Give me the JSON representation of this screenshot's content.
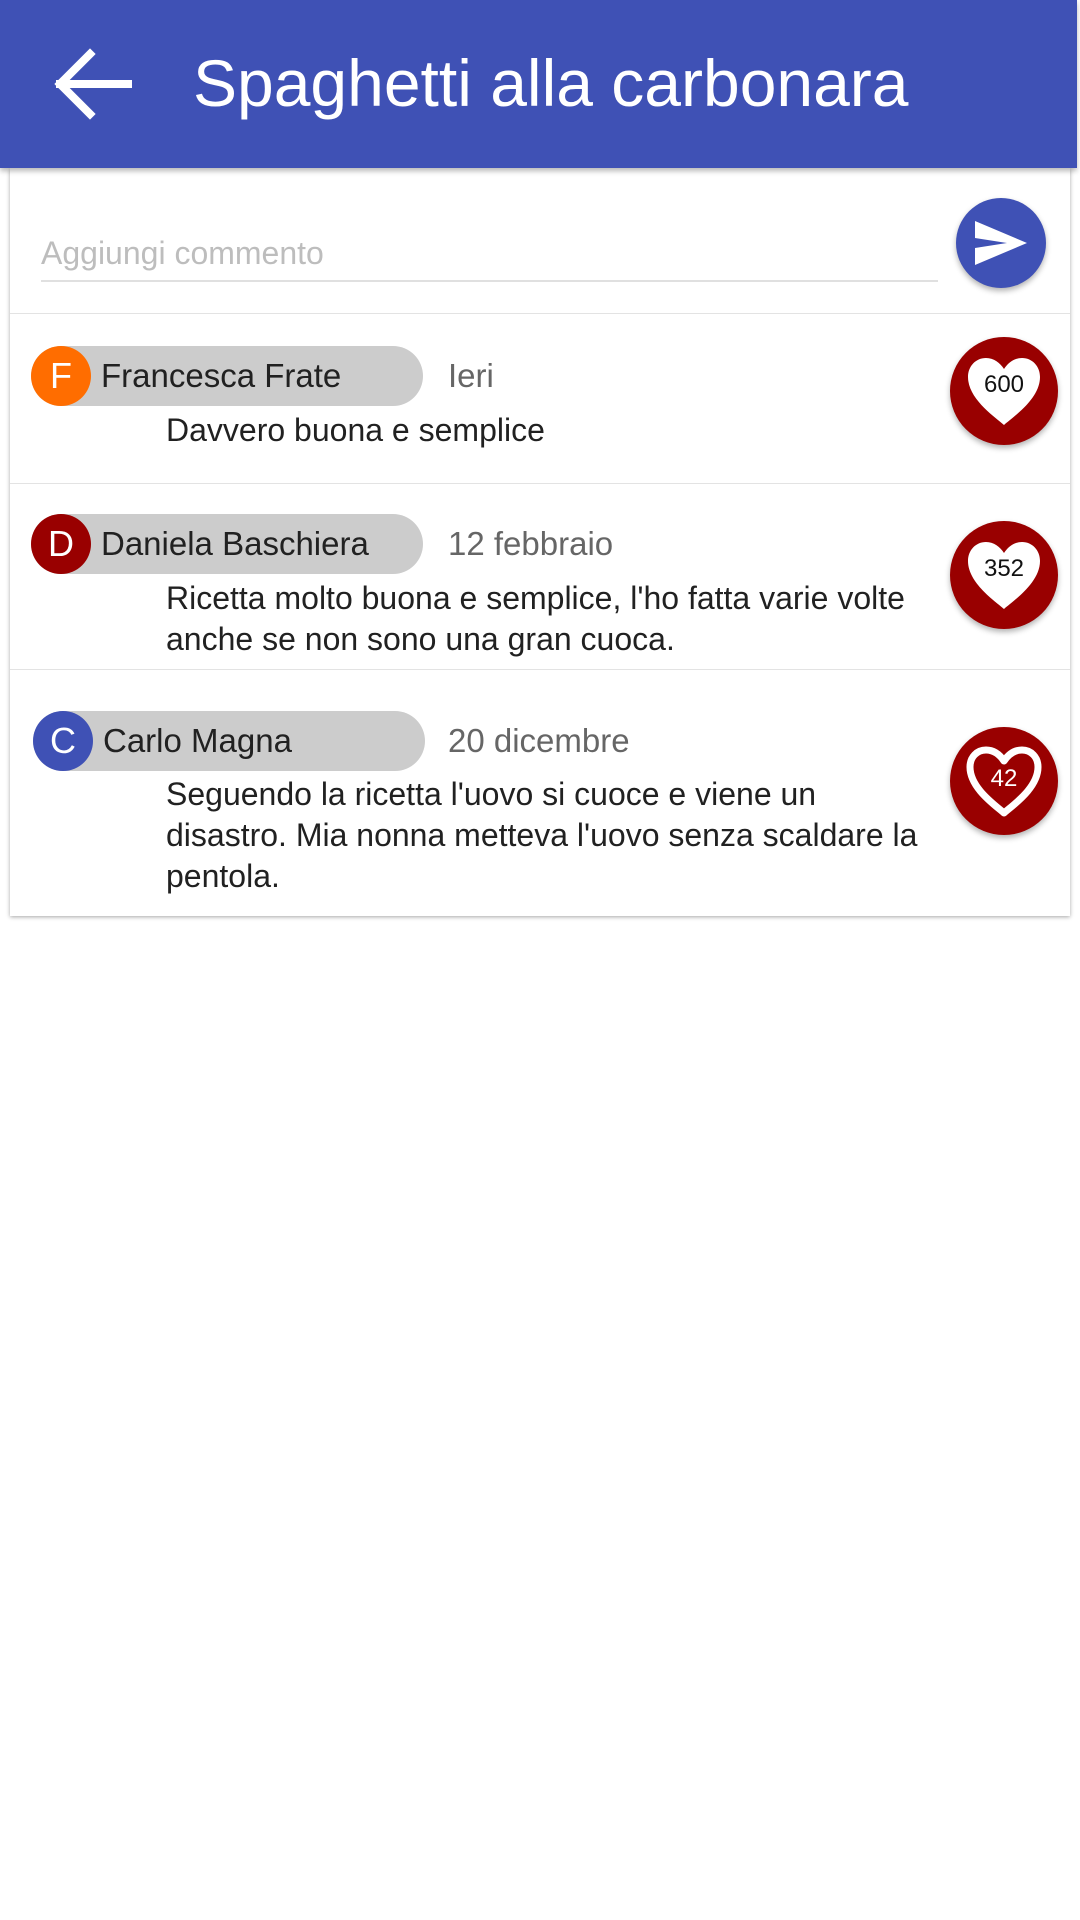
{
  "header": {
    "title": "Spaghetti alla carbonara",
    "back_icon": "arrow-back-icon"
  },
  "composer": {
    "placeholder": "Aggiungi commento",
    "value": "",
    "send_icon": "send-icon"
  },
  "colors": {
    "primary": "#3f51b5",
    "like_background": "#990000",
    "chip_background": "#cccccc"
  },
  "comments": [
    {
      "avatar_letter": "F",
      "avatar_color": "#ff6d00",
      "name": "Francesca Frate",
      "date": "Ieri",
      "text": "Davvero buona e semplice",
      "likes": "600",
      "like_icon": "heart-filled-icon"
    },
    {
      "avatar_letter": "D",
      "avatar_color": "#990000",
      "name": "Daniela Baschiera",
      "date": "12 febbraio",
      "text": "Ricetta molto buona e semplice, l'ho fatta varie volte anche se non sono una gran cuoca.",
      "likes": "352",
      "like_icon": "heart-filled-icon"
    },
    {
      "avatar_letter": "C",
      "avatar_color": "#3f51b5",
      "name": "Carlo Magna",
      "date": "20 dicembre",
      "text": "Seguendo la ricetta l'uovo si cuoce e viene un disastro. Mia nonna metteva l'uovo senza scaldare la pentola.",
      "likes": "42",
      "like_icon": "heart-outline-icon"
    }
  ]
}
